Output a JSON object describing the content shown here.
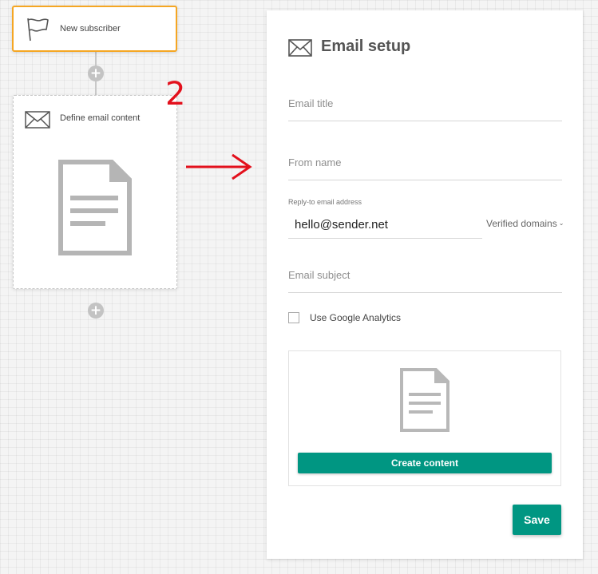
{
  "workflow": {
    "trigger_node": {
      "label": "New subscriber",
      "icon": "flag-icon"
    },
    "email_node": {
      "label": "Define email content",
      "icon": "envelope-icon",
      "preview_icon": "document-icon"
    },
    "add_step_symbol": "+",
    "step_number": "2"
  },
  "panel": {
    "title": "Email setup",
    "icon": "envelope-icon",
    "fields": {
      "email_title_placeholder": "Email title",
      "from_name_placeholder": "From name",
      "reply_to_label": "Reply-to email address",
      "reply_to_value": "hello@sender.net",
      "verified_domains_label": "Verified domains",
      "email_subject_placeholder": "Email subject"
    },
    "google_analytics": {
      "label": "Use Google Analytics",
      "checked": false
    },
    "content_box": {
      "icon": "document-icon",
      "button_label": "Create content"
    },
    "save_label": "Save"
  },
  "colors": {
    "accent": "#009682",
    "trigger_border": "#f5a623",
    "annotation_red": "#e3101c"
  }
}
